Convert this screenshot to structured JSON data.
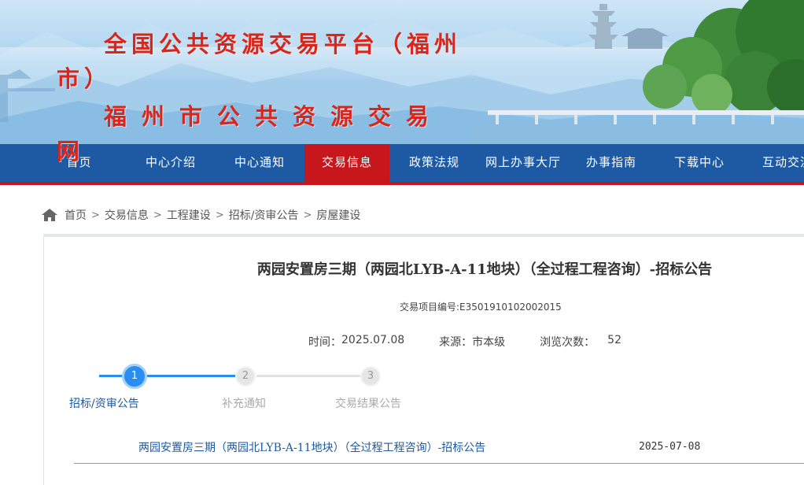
{
  "header": {
    "title": "全国公共资源交易平台（福州市）",
    "subtitle": "福州市公共资源交易网"
  },
  "nav": {
    "items": [
      {
        "label": "首页",
        "active": false
      },
      {
        "label": "中心介绍",
        "active": false
      },
      {
        "label": "中心通知",
        "active": false
      },
      {
        "label": "交易信息",
        "active": true
      },
      {
        "label": "政策法规",
        "active": false
      },
      {
        "label": "网上办事大厅",
        "active": false
      },
      {
        "label": "办事指南",
        "active": false
      },
      {
        "label": "下载中心",
        "active": false
      },
      {
        "label": "互动交流",
        "active": false
      }
    ]
  },
  "breadcrumb": {
    "items": [
      "首页",
      "交易信息",
      "工程建设",
      "招标/资审公告",
      "房屋建设"
    ],
    "separator": ">"
  },
  "article": {
    "title": "两园安置房三期（两园北LYB-A-11地块）（全过程工程咨询）-招标公告",
    "project_no": "交易项目编号:E3501910102002015",
    "time_label": "时间：",
    "time": "2025.07.08",
    "source_label": "来源：",
    "source": "市本级",
    "views_label": "浏览次数：",
    "views": "52"
  },
  "steps": [
    {
      "number": "1",
      "label": "招标/资审公告",
      "active": true
    },
    {
      "number": "2",
      "label": "补充通知",
      "active": false
    },
    {
      "number": "3",
      "label": "交易结果公告",
      "active": false
    }
  ],
  "list": [
    {
      "title": "两园安置房三期（两园北LYB-A-11地块）（全过程工程咨询）-招标公告",
      "date": "2025-07-08"
    }
  ],
  "colors": {
    "nav_bg": "#1d5aa3",
    "nav_active": "#c8161d",
    "step_active": "#2a8ef0",
    "step_inactive": "#d9d9d9",
    "title_red": "#d9261c"
  }
}
